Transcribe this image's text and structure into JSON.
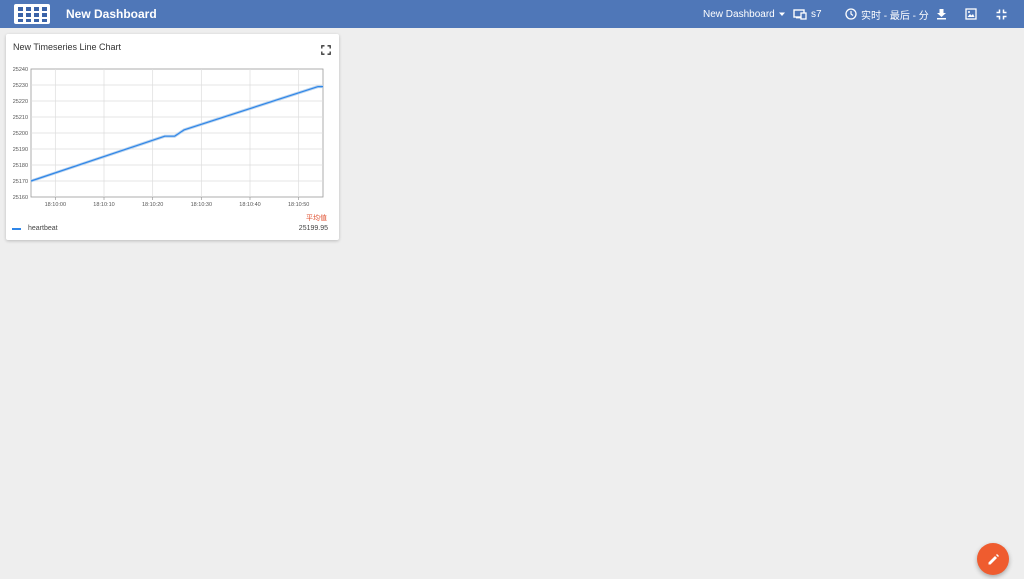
{
  "header": {
    "title": "New Dashboard",
    "dashboard_select": "New Dashboard",
    "entity_alias": "s7",
    "time_window": "实时 - 最后 - 分"
  },
  "widget": {
    "title": "New Timeseries Line Chart",
    "legend_header": "平均值",
    "legend": [
      {
        "name": "heartbeat",
        "value": "25199.95",
        "color": "#2f86e8"
      }
    ]
  },
  "chart_data": {
    "type": "line",
    "title": "New Timeseries Line Chart",
    "xlabel": "",
    "ylabel": "",
    "ylim": [
      25160,
      25240
    ],
    "yticks": [
      25160,
      25170,
      25180,
      25190,
      25200,
      25210,
      25220,
      25230,
      25240
    ],
    "xticks": [
      "18:10:00",
      "18:10:10",
      "18:10:20",
      "18:10:30",
      "18:10:40",
      "18:10:50"
    ],
    "xlim_seconds": [
      -5,
      55
    ],
    "grid": true,
    "series": [
      {
        "name": "heartbeat",
        "color": "#2f86e8",
        "x": [
          -5,
          22.5,
          23.5,
          24.5,
          25.5,
          26.5,
          54,
          55
        ],
        "y": [
          25170,
          25198,
          25198,
          25198,
          25200,
          25202,
          25229,
          25229
        ]
      }
    ]
  },
  "fab": {
    "icon": "edit-icon",
    "color": "#ef5c2f"
  },
  "colors": {
    "header": "#4f77b8",
    "background": "#eeeeee"
  }
}
